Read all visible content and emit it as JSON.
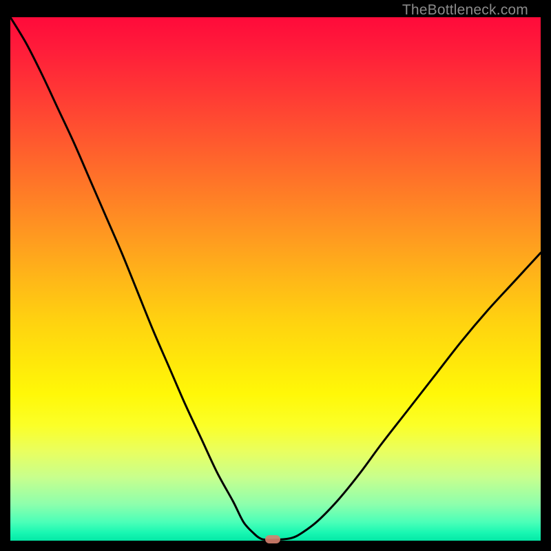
{
  "watermark": "TheBottleneck.com",
  "colors": {
    "frame": "#000000",
    "curve": "#000000",
    "marker": "#d6816f"
  },
  "chart_data": {
    "type": "line",
    "title": "",
    "xlabel": "",
    "ylabel": "",
    "xlim": [
      0,
      100
    ],
    "ylim": [
      0,
      100
    ],
    "x": [
      0,
      3,
      6,
      9,
      12,
      15,
      18,
      21,
      24,
      27,
      30,
      33,
      36,
      39,
      42,
      44,
      46,
      47,
      48,
      50.5,
      53,
      55,
      58,
      62,
      66,
      70,
      75,
      80,
      85,
      90,
      95,
      100
    ],
    "values": [
      100,
      95,
      89,
      82.5,
      76,
      69,
      62,
      55,
      47.5,
      40,
      33,
      26,
      19.5,
      13,
      7.5,
      3.5,
      1.3,
      0.5,
      0.2,
      0.2,
      0.5,
      1.5,
      3.8,
      8,
      13,
      18.5,
      25,
      31.5,
      38,
      44,
      49.5,
      55
    ],
    "marker_x": 49.5,
    "marker_y": 0
  }
}
